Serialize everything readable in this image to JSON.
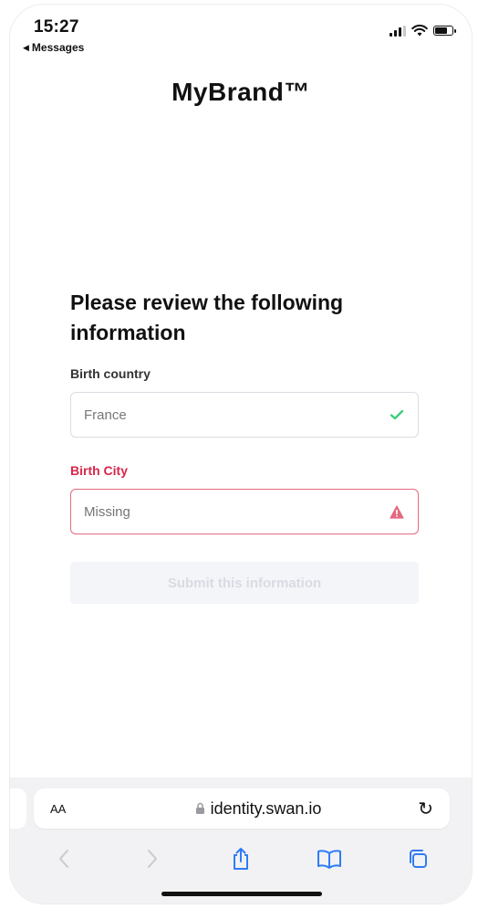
{
  "status_bar": {
    "time": "15:27",
    "back_label": "Messages",
    "icons": [
      "signal-icon",
      "wifi-icon",
      "battery-icon"
    ]
  },
  "brand": {
    "name": "MyBrand™"
  },
  "form": {
    "heading": "Please review the following information",
    "fields": [
      {
        "label": "Birth country",
        "value": "France",
        "placeholder": "",
        "status": "valid",
        "status_icon": "check-icon"
      },
      {
        "label": "Birth City",
        "value": "",
        "placeholder": "Missing",
        "status": "error",
        "status_icon": "warning-icon"
      }
    ],
    "submit_label": "Submit this information"
  },
  "browser": {
    "aa_label": "AA",
    "url": "identity.swan.io",
    "toolbar_icons": [
      "back-icon",
      "forward-icon",
      "share-icon",
      "bookmarks-icon",
      "tabs-icon"
    ]
  },
  "colors": {
    "error": "#d9254a",
    "success": "#3ccf7a",
    "ios_blue": "#2f7cf6"
  }
}
